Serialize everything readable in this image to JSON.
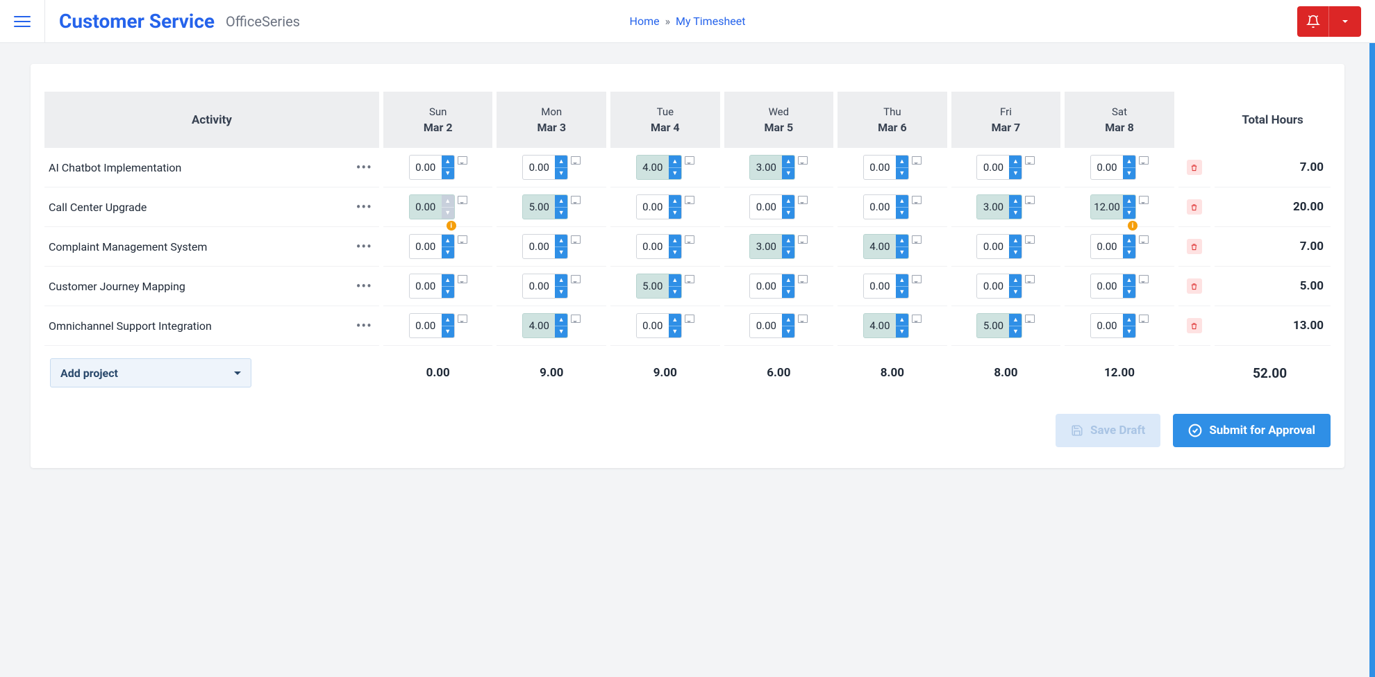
{
  "header": {
    "title": "Customer Service",
    "subtitle": "OfficeSeries",
    "breadcrumbs": [
      "Home",
      "My Timesheet"
    ]
  },
  "table": {
    "activity_header": "Activity",
    "total_header": "Total Hours",
    "days": [
      {
        "dow": "Sun",
        "date": "Mar 2"
      },
      {
        "dow": "Mon",
        "date": "Mar 3"
      },
      {
        "dow": "Tue",
        "date": "Mar 4"
      },
      {
        "dow": "Wed",
        "date": "Mar 5"
      },
      {
        "dow": "Thu",
        "date": "Mar 6"
      },
      {
        "dow": "Fri",
        "date": "Mar 7"
      },
      {
        "dow": "Sat",
        "date": "Mar 8"
      }
    ],
    "rows": [
      {
        "activity": "AI Chatbot Implementation",
        "cells": [
          {
            "value": "0.00",
            "highlight": false
          },
          {
            "value": "0.00",
            "highlight": false
          },
          {
            "value": "4.00",
            "highlight": true
          },
          {
            "value": "3.00",
            "highlight": true
          },
          {
            "value": "0.00",
            "highlight": false
          },
          {
            "value": "0.00",
            "highlight": false
          },
          {
            "value": "0.00",
            "highlight": false
          }
        ],
        "total": "7.00"
      },
      {
        "activity": "Call Center Upgrade",
        "cells": [
          {
            "value": "0.00",
            "highlight": true,
            "disabled": true,
            "warn": true
          },
          {
            "value": "5.00",
            "highlight": true
          },
          {
            "value": "0.00",
            "highlight": false
          },
          {
            "value": "0.00",
            "highlight": false
          },
          {
            "value": "0.00",
            "highlight": false
          },
          {
            "value": "3.00",
            "highlight": true
          },
          {
            "value": "12.00",
            "highlight": true,
            "warn": true
          }
        ],
        "total": "20.00"
      },
      {
        "activity": "Complaint Management System",
        "cells": [
          {
            "value": "0.00",
            "highlight": false
          },
          {
            "value": "0.00",
            "highlight": false
          },
          {
            "value": "0.00",
            "highlight": false
          },
          {
            "value": "3.00",
            "highlight": true
          },
          {
            "value": "4.00",
            "highlight": true
          },
          {
            "value": "0.00",
            "highlight": false
          },
          {
            "value": "0.00",
            "highlight": false
          }
        ],
        "total": "7.00"
      },
      {
        "activity": "Customer Journey Mapping",
        "cells": [
          {
            "value": "0.00",
            "highlight": false
          },
          {
            "value": "0.00",
            "highlight": false
          },
          {
            "value": "5.00",
            "highlight": true
          },
          {
            "value": "0.00",
            "highlight": false
          },
          {
            "value": "0.00",
            "highlight": false
          },
          {
            "value": "0.00",
            "highlight": false
          },
          {
            "value": "0.00",
            "highlight": false
          }
        ],
        "total": "5.00"
      },
      {
        "activity": "Omnichannel Support Integration",
        "cells": [
          {
            "value": "0.00",
            "highlight": false
          },
          {
            "value": "4.00",
            "highlight": true
          },
          {
            "value": "0.00",
            "highlight": false
          },
          {
            "value": "0.00",
            "highlight": false
          },
          {
            "value": "4.00",
            "highlight": true
          },
          {
            "value": "5.00",
            "highlight": true
          },
          {
            "value": "0.00",
            "highlight": false
          }
        ],
        "total": "13.00"
      }
    ],
    "column_totals": [
      "0.00",
      "9.00",
      "9.00",
      "6.00",
      "8.00",
      "8.00",
      "12.00"
    ],
    "grand_total": "52.00",
    "add_project_label": "Add project"
  },
  "buttons": {
    "save_draft": "Save Draft",
    "submit": "Submit for Approval"
  }
}
